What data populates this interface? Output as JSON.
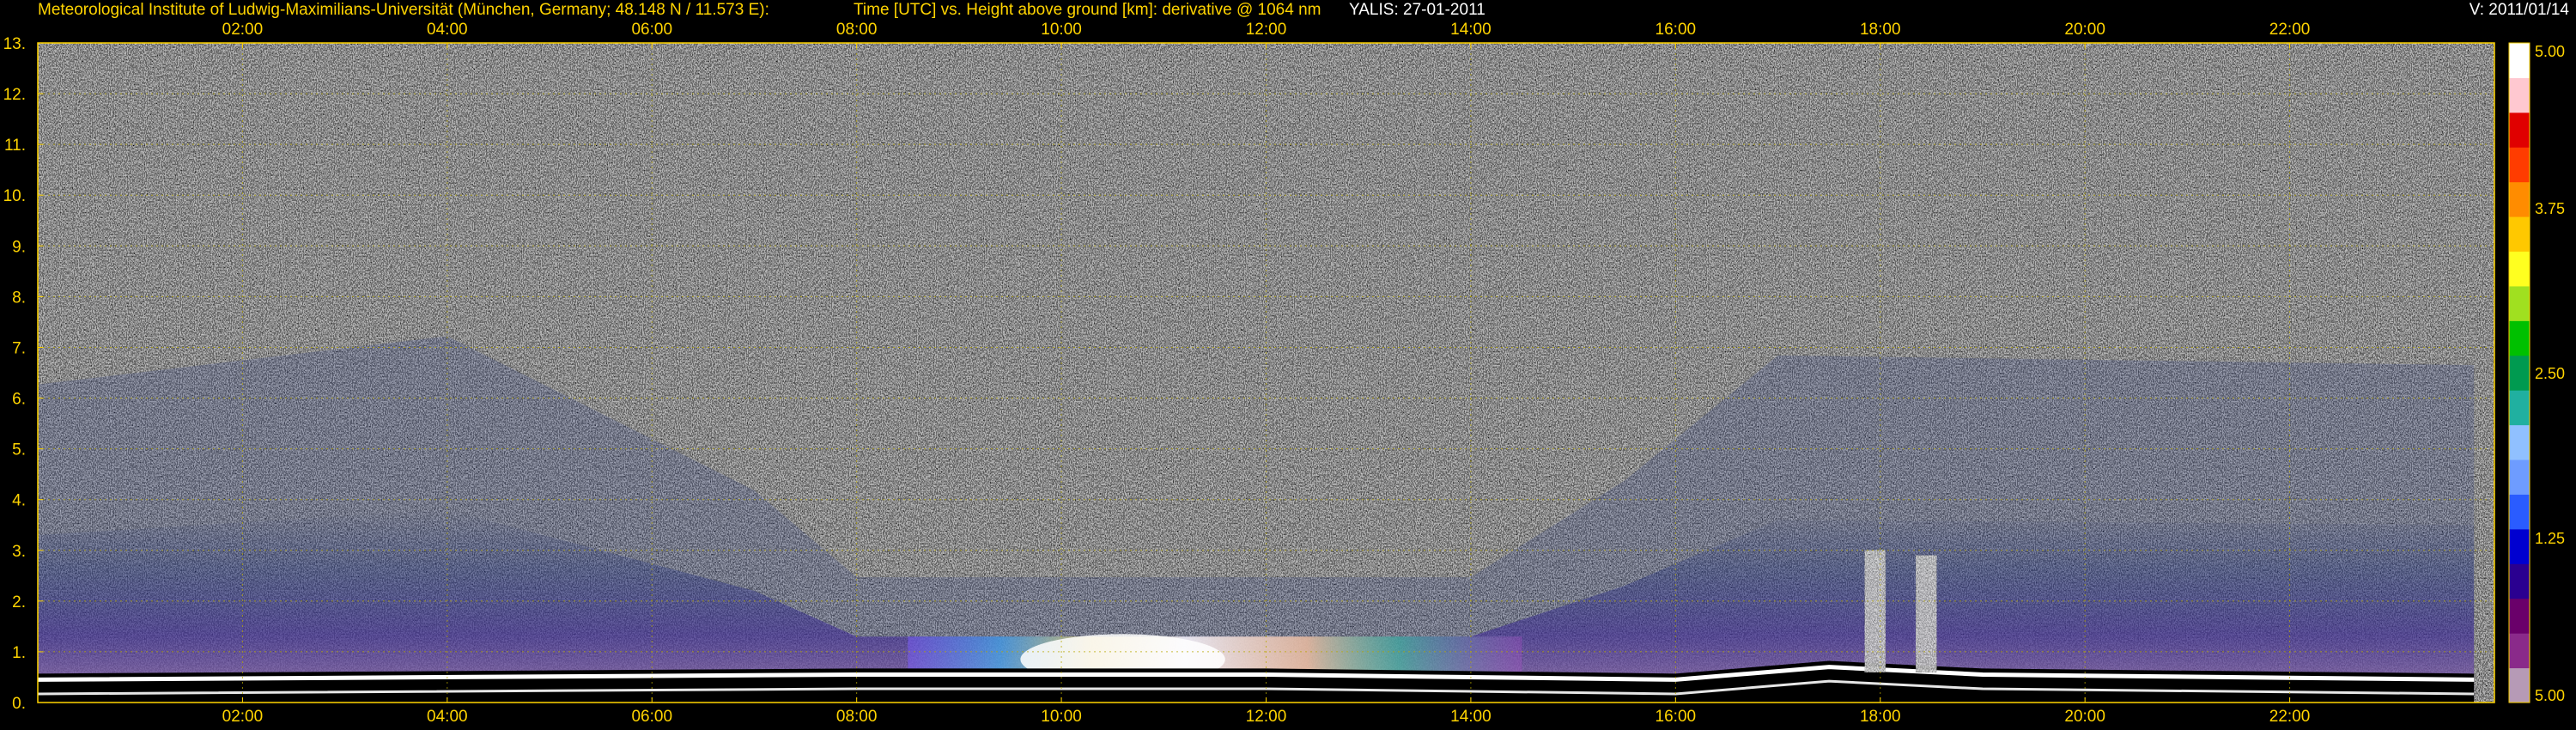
{
  "header": {
    "institute": "Meteorological Institute of Ludwig-Maximilians-Universität (München, Germany; 48.148 N / 11.573 E):",
    "description": "Time [UTC] vs. Height above ground [km]: derivative @ 1064 nm",
    "instrument": "YALIS: 27-01-2011",
    "version": "V: 2011/01/14"
  },
  "colors": {
    "background": "#000000",
    "text": "#ffd400",
    "grid": "#b8a800",
    "colorbar": [
      "#b69ab6",
      "#8a2a8a",
      "#6a006a",
      "#2a0090",
      "#0000d0",
      "#2a5cff",
      "#6e9cff",
      "#90c0ff",
      "#20b0a0",
      "#009a50",
      "#00c000",
      "#a0e020",
      "#ffff20",
      "#ffc800",
      "#ff8c00",
      "#ff3c00",
      "#e00000",
      "#ffc8d0",
      "#ffffff"
    ]
  },
  "chart_data": {
    "type": "heatmap",
    "title": "Time [UTC] vs. Height above ground [km]: derivative @ 1064 nm",
    "xlabel": "Time [UTC]",
    "ylabel": "Height above ground [km]",
    "x_range_hours": [
      0,
      24
    ],
    "y_range_km": [
      0,
      13
    ],
    "x_ticks": [
      "02:00",
      "04:00",
      "06:00",
      "08:00",
      "10:00",
      "12:00",
      "14:00",
      "16:00",
      "18:00",
      "20:00",
      "22:00"
    ],
    "x_tick_hours": [
      2,
      4,
      6,
      8,
      10,
      12,
      14,
      16,
      18,
      20,
      22
    ],
    "y_ticks": [
      0,
      1,
      2,
      3,
      4,
      5,
      6,
      7,
      8,
      9,
      10,
      11,
      12,
      13
    ],
    "y_tick_labels": [
      "0.",
      "1.",
      "2.",
      "3.",
      "4.",
      "5.",
      "6.",
      "7.",
      "8.",
      "9.",
      "10.",
      "11.",
      "12.",
      "13."
    ],
    "grid": true,
    "colorbar": {
      "tick_labels": [
        "5.00",
        "3.75",
        "2.50",
        "1.25",
        "5.00"
      ],
      "tick_fractions": [
        1.0,
        0.75,
        0.5,
        0.25,
        0.0
      ]
    },
    "features": {
      "boundary_layer_top_km": [
        {
          "hour": 0.0,
          "km": 0.45
        },
        {
          "hour": 8.0,
          "km": 0.55
        },
        {
          "hour": 12.0,
          "km": 0.55
        },
        {
          "hour": 14.0,
          "km": 0.5
        },
        {
          "hour": 16.0,
          "km": 0.45
        },
        {
          "hour": 17.5,
          "km": 0.7
        },
        {
          "hour": 19.0,
          "km": 0.55
        },
        {
          "hour": 23.8,
          "km": 0.45
        }
      ],
      "aerosol_layer_top_km": [
        {
          "hour": 0.0,
          "km": 3.3
        },
        {
          "hour": 4.0,
          "km": 3.8
        },
        {
          "hour": 7.0,
          "km": 2.2
        },
        {
          "hour": 8.0,
          "km": 1.3
        },
        {
          "hour": 10.0,
          "km": 1.3
        },
        {
          "hour": 14.0,
          "km": 1.3
        },
        {
          "hour": 15.5,
          "km": 2.3
        },
        {
          "hour": 17.0,
          "km": 3.6
        },
        {
          "hour": 23.8,
          "km": 3.5
        }
      ],
      "cloud_events": [
        {
          "hour_start": 17.85,
          "hour_end": 18.05,
          "km_bottom": 0.6,
          "km_top": 3.0
        },
        {
          "hour_start": 18.35,
          "hour_end": 18.55,
          "km_bottom": 0.6,
          "km_top": 2.9
        }
      ],
      "bright_layer": {
        "hour_start": 8.5,
        "hour_end": 14.5,
        "km_bottom": 0.6,
        "km_top": 1.3
      }
    }
  }
}
